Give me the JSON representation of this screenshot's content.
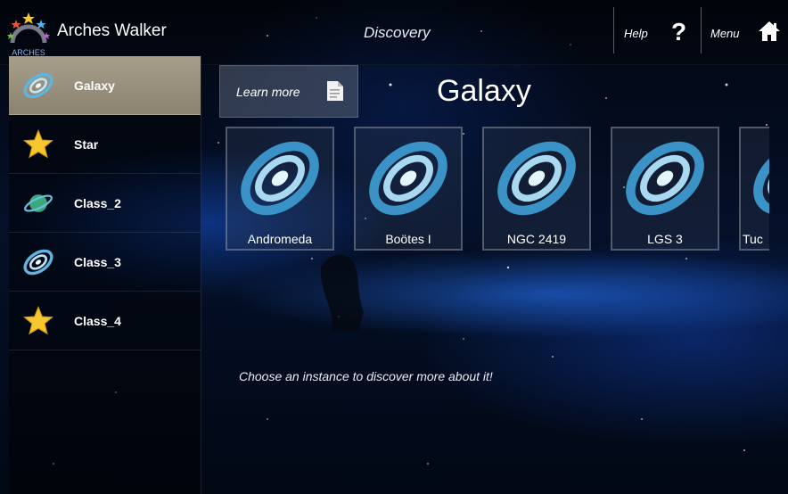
{
  "header": {
    "app_title": "Arches Walker",
    "logo_text": "ARCHES",
    "screen_title": "Discovery",
    "help_label": "Help",
    "help_icon": "?",
    "menu_label": "Menu"
  },
  "sidebar": {
    "items": [
      {
        "label": "Galaxy",
        "icon": "galaxy-icon",
        "active": true
      },
      {
        "label": "Star",
        "icon": "star-icon",
        "active": false
      },
      {
        "label": "Class_2",
        "icon": "planet-icon",
        "active": false
      },
      {
        "label": "Class_3",
        "icon": "galaxy-icon",
        "active": false
      },
      {
        "label": "Class_4",
        "icon": "star-icon",
        "active": false
      }
    ]
  },
  "main": {
    "learn_more_label": "Learn more",
    "title": "Galaxy",
    "instances": [
      {
        "label": "Andromeda",
        "icon": "galaxy-icon"
      },
      {
        "label": "Boötes I",
        "icon": "galaxy-icon"
      },
      {
        "label": "NGC 2419",
        "icon": "galaxy-icon"
      },
      {
        "label": "LGS 3",
        "icon": "galaxy-icon"
      },
      {
        "label": "Tuc",
        "icon": "galaxy-icon"
      }
    ],
    "hint": "Choose an instance to discover more about it!"
  },
  "colors": {
    "active_item": "#a79e8b",
    "galaxy_blue": "#4aa3d6",
    "star_yellow": "#f6c72f"
  }
}
